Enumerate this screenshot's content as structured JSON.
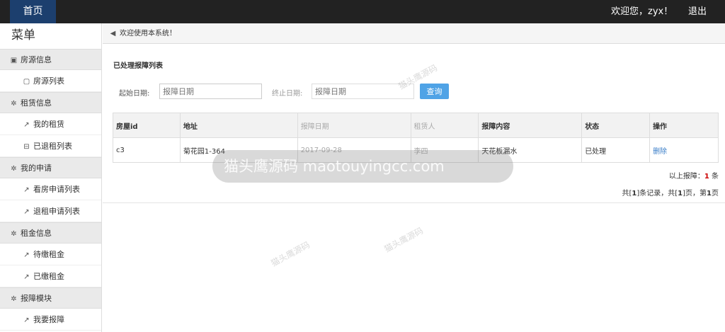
{
  "topbar": {
    "home": "首页",
    "welcome": "欢迎您，zyx！",
    "logout": "退出"
  },
  "sidebar": {
    "title": "菜单",
    "groups": [
      {
        "label": "房源信息",
        "icon": "contact-card-icon",
        "items": [
          {
            "label": "房源列表",
            "icon": "file-icon"
          }
        ]
      },
      {
        "label": "租赁信息",
        "icon": "gear-icon",
        "items": [
          {
            "label": "我的租赁",
            "icon": "wrench-icon"
          },
          {
            "label": "已退租列表",
            "icon": "trash-icon"
          }
        ]
      },
      {
        "label": "我的申请",
        "icon": "gear-icon",
        "items": [
          {
            "label": "看房申请列表",
            "icon": "wrench-icon"
          },
          {
            "label": "退租申请列表",
            "icon": "wrench-icon"
          }
        ]
      },
      {
        "label": "租金信息",
        "icon": "gear-icon",
        "items": [
          {
            "label": "待缴租金",
            "icon": "wrench-icon"
          },
          {
            "label": "已缴租金",
            "icon": "wrench-icon"
          }
        ]
      },
      {
        "label": "报障模块",
        "icon": "gear-icon",
        "items": [
          {
            "label": "我要报障",
            "icon": "wrench-icon"
          }
        ]
      }
    ]
  },
  "notice": {
    "text": "欢迎使用本系统！",
    "icon": "speaker-icon"
  },
  "main": {
    "panel_title": "已处理报障列表",
    "search": {
      "start_label": "起始日期:",
      "start_placeholder": "报障日期",
      "end_label": "终止日期:",
      "end_placeholder": "报障日期",
      "button": "查询"
    },
    "table": {
      "headers": [
        "房屋id",
        "地址",
        "报障日期",
        "租赁人",
        "报障内容",
        "状态",
        "操作"
      ],
      "rows": [
        [
          "c3",
          "菊花园1-364",
          "2017-09-28",
          "李四",
          "天花板漏水",
          "已处理",
          "删除"
        ]
      ]
    },
    "summary": {
      "prefix": "以上报障：",
      "count": "1",
      "suffix": " 条"
    },
    "pager": {
      "p1": "共[",
      "total_records": "1",
      "p2": "]条记录，共[",
      "total_pages": "1",
      "p3": "]页，第",
      "current_page": "1",
      "p4": "页"
    }
  },
  "watermark": {
    "text": "猫头鹰源码 maotouyingcc.com",
    "small": "猫头鹰源码"
  }
}
